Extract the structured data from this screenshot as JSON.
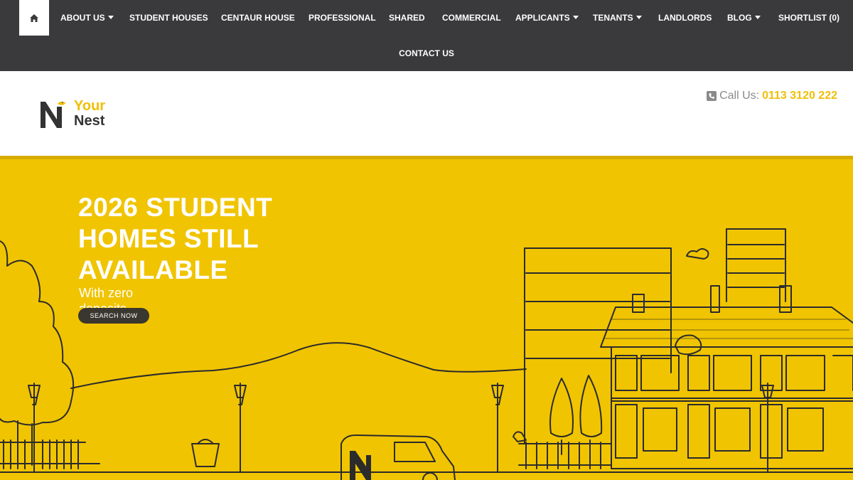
{
  "nav": {
    "home_icon": "home-icon",
    "items": [
      {
        "label": "ABOUT US",
        "dropdown": true
      },
      {
        "label": "STUDENT HOUSES",
        "dropdown": false
      },
      {
        "label": "CENTAUR HOUSE",
        "dropdown": false
      },
      {
        "label": "PROFESSIONAL",
        "dropdown": false
      },
      {
        "label": "SHARED",
        "dropdown": false
      },
      {
        "label": "COMMERCIAL",
        "dropdown": false
      },
      {
        "label": "APPLICANTS",
        "dropdown": true
      },
      {
        "label": "TENANTS",
        "dropdown": true
      },
      {
        "label": "LANDLORDS",
        "dropdown": false
      },
      {
        "label": "BLOG",
        "dropdown": true
      },
      {
        "label": "SHORTLIST (0)",
        "dropdown": false
      }
    ],
    "contact": "CONTACT US"
  },
  "header": {
    "logo_line1": "Your",
    "logo_line2": "Nest",
    "call_label": "Call Us:",
    "phone": "0113 3120 222",
    "phone_icon": "phone-square-icon"
  },
  "hero": {
    "title_line1": "2026 STUDENT",
    "title_line2": "HOMES STILL",
    "title_line3": "AVAILABLE",
    "subtitle": "With zero deposits",
    "button": "SEARCH NOW"
  },
  "colors": {
    "nav_bg": "#3a3a3c",
    "accent": "#f0c400",
    "text_white": "#ffffff",
    "ink": "#2b2b2b"
  }
}
